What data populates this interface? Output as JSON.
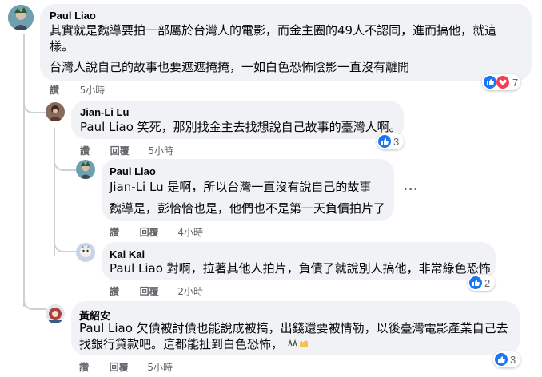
{
  "comments": [
    {
      "author": "Paul Liao",
      "text_line1": "其實就是魏導要拍一部屬於台灣人的電影，而金主圈的49人不認同，進而搞他，就這",
      "text_line1b": "樣。",
      "text_line2": "台灣人說自己的故事也要遮遮掩掩，一如白色恐怖陰影一直沒有離開",
      "like_label": "讚",
      "time": "5小時",
      "reaction_count": "7"
    },
    {
      "author": "Jian-Li Lu",
      "mention": "Paul Liao",
      "text": " 笑死，那別找金主去找想說自己故事的臺灣人啊。",
      "like_label": "讚",
      "reply_label": "回覆",
      "time": "5小時",
      "reaction_count": "3"
    },
    {
      "author": "Paul Liao",
      "mention": "Jian-Li Lu",
      "text": " 是啊，所以台灣一直沒有說自己的故事",
      "text2": "魏導是，彭恰恰也是，他們也不是第一天負債拍片了",
      "like_label": "讚",
      "reply_label": "回覆",
      "time": "4小時"
    },
    {
      "author": "Kai Kai",
      "mention": "Paul Liao",
      "text": " 對啊，拉著其他人拍片，負債了就說別人搞他，非常綠色恐怖",
      "like_label": "讚",
      "reply_label": "回覆",
      "time": "2小時",
      "reaction_count": "2"
    },
    {
      "author": "黃紹安",
      "mention": "Paul Liao",
      "text": " 欠債被討債也能說成被搞，出錢還要被情勒，以後臺灣電影產業自己去",
      "text2": "找銀行貸款吧。這都能扯到白色恐怖，",
      "like_label": "讚",
      "reply_label": "回覆",
      "time": "5小時",
      "reaction_count": "3"
    }
  ],
  "colors": {
    "bubble": "#f0f2f5",
    "like_blue": "#1877f2",
    "love_red": "#f33e58",
    "meta_gray": "#65676b"
  }
}
